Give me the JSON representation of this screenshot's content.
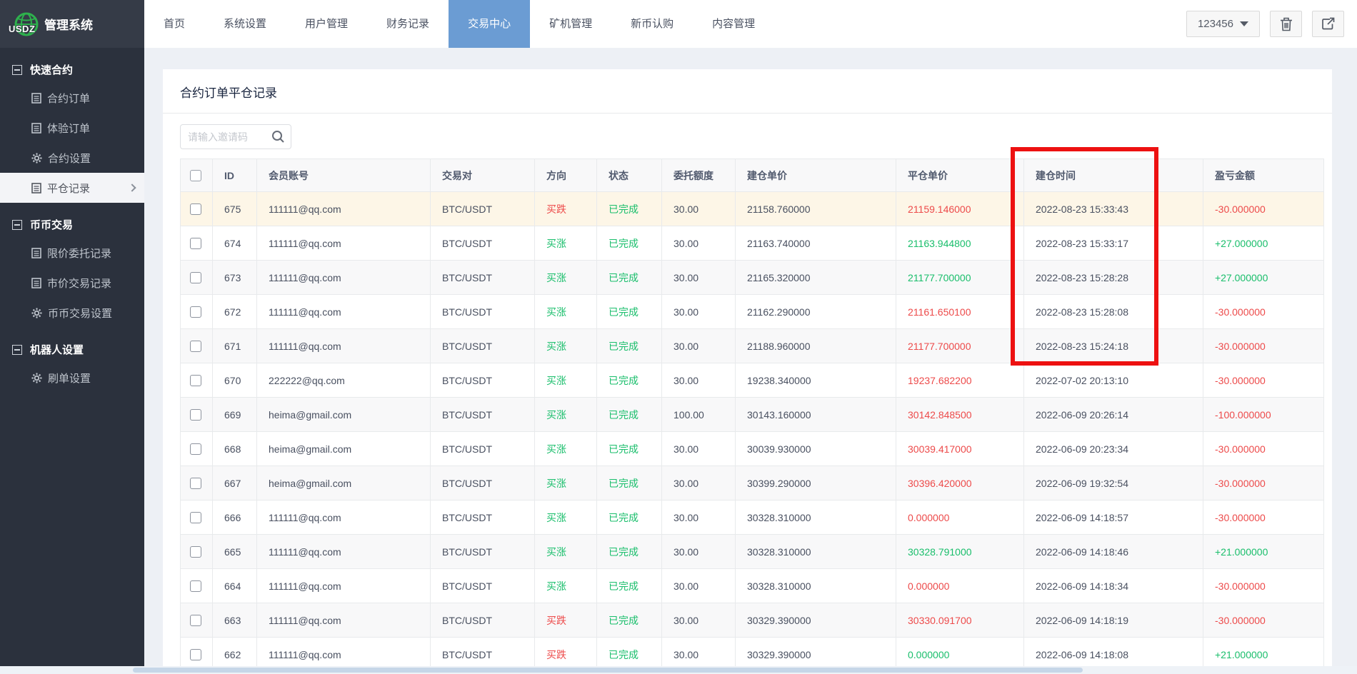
{
  "header": {
    "logo_text": "USDZ",
    "app_name": "管理系统",
    "nav": [
      {
        "label": "首页",
        "active": false
      },
      {
        "label": "系统设置",
        "active": false
      },
      {
        "label": "用户管理",
        "active": false
      },
      {
        "label": "财务记录",
        "active": false
      },
      {
        "label": "交易中心",
        "active": true
      },
      {
        "label": "矿机管理",
        "active": false
      },
      {
        "label": "新币认购",
        "active": false
      },
      {
        "label": "内容管理",
        "active": false
      }
    ],
    "user_menu_label": "123456",
    "icons": [
      "trash-icon",
      "export-icon"
    ]
  },
  "sidebar": {
    "sections": [
      {
        "title": "快速合约",
        "items": [
          {
            "label": "合约订单",
            "icon": "list",
            "active": false
          },
          {
            "label": "体验订单",
            "icon": "list",
            "active": false
          },
          {
            "label": "合约设置",
            "icon": "gear",
            "active": false
          },
          {
            "label": "平仓记录",
            "icon": "list",
            "active": true
          }
        ]
      },
      {
        "title": "币币交易",
        "items": [
          {
            "label": "限价委托记录",
            "icon": "list",
            "active": false
          },
          {
            "label": "市价交易记录",
            "icon": "list",
            "active": false
          },
          {
            "label": "币币交易设置",
            "icon": "gear",
            "active": false
          }
        ]
      },
      {
        "title": "机器人设置",
        "items": [
          {
            "label": "刷单设置",
            "icon": "gear",
            "active": false
          }
        ]
      }
    ]
  },
  "main": {
    "title": "合约订单平仓记录",
    "search_placeholder": "请输入邀请码",
    "table": {
      "columns": [
        "ID",
        "会员账号",
        "交易对",
        "方向",
        "状态",
        "委托额度",
        "建仓单价",
        "平仓单价",
        "建仓时间",
        "盈亏金额"
      ],
      "rows": [
        {
          "id": "675",
          "account": "111111@qq.com",
          "pair": "BTC/USDT",
          "direction": "买跌",
          "direction_color": "red",
          "status": "已完成",
          "amount": "30.00",
          "open_price": "21158.760000",
          "close_price": "21159.146000",
          "close_color": "red",
          "open_time": "2022-08-23 15:33:43",
          "pnl": "-30.000000",
          "pnl_color": "red",
          "highlight": true
        },
        {
          "id": "674",
          "account": "111111@qq.com",
          "pair": "BTC/USDT",
          "direction": "买涨",
          "direction_color": "green",
          "status": "已完成",
          "amount": "30.00",
          "open_price": "21163.740000",
          "close_price": "21163.944800",
          "close_color": "green",
          "open_time": "2022-08-23 15:33:17",
          "pnl": "+27.000000",
          "pnl_color": "green",
          "highlight": false
        },
        {
          "id": "673",
          "account": "111111@qq.com",
          "pair": "BTC/USDT",
          "direction": "买涨",
          "direction_color": "green",
          "status": "已完成",
          "amount": "30.00",
          "open_price": "21165.320000",
          "close_price": "21177.700000",
          "close_color": "green",
          "open_time": "2022-08-23 15:28:28",
          "pnl": "+27.000000",
          "pnl_color": "green",
          "highlight": false
        },
        {
          "id": "672",
          "account": "111111@qq.com",
          "pair": "BTC/USDT",
          "direction": "买涨",
          "direction_color": "green",
          "status": "已完成",
          "amount": "30.00",
          "open_price": "21162.290000",
          "close_price": "21161.650100",
          "close_color": "red",
          "open_time": "2022-08-23 15:28:08",
          "pnl": "-30.000000",
          "pnl_color": "red",
          "highlight": false
        },
        {
          "id": "671",
          "account": "111111@qq.com",
          "pair": "BTC/USDT",
          "direction": "买涨",
          "direction_color": "green",
          "status": "已完成",
          "amount": "30.00",
          "open_price": "21188.960000",
          "close_price": "21177.700000",
          "close_color": "red",
          "open_time": "2022-08-23 15:24:18",
          "pnl": "-30.000000",
          "pnl_color": "red",
          "highlight": false
        },
        {
          "id": "670",
          "account": "222222@qq.com",
          "pair": "BTC/USDT",
          "direction": "买涨",
          "direction_color": "green",
          "status": "已完成",
          "amount": "30.00",
          "open_price": "19238.340000",
          "close_price": "19237.682200",
          "close_color": "red",
          "open_time": "2022-07-02 20:13:10",
          "pnl": "-30.000000",
          "pnl_color": "red",
          "highlight": false
        },
        {
          "id": "669",
          "account": "heima@gmail.com",
          "pair": "BTC/USDT",
          "direction": "买涨",
          "direction_color": "green",
          "status": "已完成",
          "amount": "100.00",
          "open_price": "30143.160000",
          "close_price": "30142.848500",
          "close_color": "red",
          "open_time": "2022-06-09 20:26:14",
          "pnl": "-100.000000",
          "pnl_color": "red",
          "highlight": false
        },
        {
          "id": "668",
          "account": "heima@gmail.com",
          "pair": "BTC/USDT",
          "direction": "买涨",
          "direction_color": "green",
          "status": "已完成",
          "amount": "30.00",
          "open_price": "30039.930000",
          "close_price": "30039.417000",
          "close_color": "red",
          "open_time": "2022-06-09 20:23:34",
          "pnl": "-30.000000",
          "pnl_color": "red",
          "highlight": false
        },
        {
          "id": "667",
          "account": "heima@gmail.com",
          "pair": "BTC/USDT",
          "direction": "买涨",
          "direction_color": "green",
          "status": "已完成",
          "amount": "30.00",
          "open_price": "30399.290000",
          "close_price": "30396.420000",
          "close_color": "red",
          "open_time": "2022-06-09 19:32:54",
          "pnl": "-30.000000",
          "pnl_color": "red",
          "highlight": false
        },
        {
          "id": "666",
          "account": "111111@qq.com",
          "pair": "BTC/USDT",
          "direction": "买涨",
          "direction_color": "green",
          "status": "已完成",
          "amount": "30.00",
          "open_price": "30328.310000",
          "close_price": "0.000000",
          "close_color": "red",
          "open_time": "2022-06-09 14:18:57",
          "pnl": "-30.000000",
          "pnl_color": "red",
          "highlight": false
        },
        {
          "id": "665",
          "account": "111111@qq.com",
          "pair": "BTC/USDT",
          "direction": "买涨",
          "direction_color": "green",
          "status": "已完成",
          "amount": "30.00",
          "open_price": "30328.310000",
          "close_price": "30328.791000",
          "close_color": "green",
          "open_time": "2022-06-09 14:18:46",
          "pnl": "+21.000000",
          "pnl_color": "green",
          "highlight": false
        },
        {
          "id": "664",
          "account": "111111@qq.com",
          "pair": "BTC/USDT",
          "direction": "买涨",
          "direction_color": "green",
          "status": "已完成",
          "amount": "30.00",
          "open_price": "30328.310000",
          "close_price": "0.000000",
          "close_color": "red",
          "open_time": "2022-06-09 14:18:34",
          "pnl": "-30.000000",
          "pnl_color": "red",
          "highlight": false
        },
        {
          "id": "663",
          "account": "111111@qq.com",
          "pair": "BTC/USDT",
          "direction": "买跌",
          "direction_color": "red",
          "status": "已完成",
          "amount": "30.00",
          "open_price": "30329.390000",
          "close_price": "30330.091700",
          "close_color": "red",
          "open_time": "2022-06-09 14:18:19",
          "pnl": "-30.000000",
          "pnl_color": "red",
          "highlight": false
        },
        {
          "id": "662",
          "account": "111111@qq.com",
          "pair": "BTC/USDT",
          "direction": "买跌",
          "direction_color": "red",
          "status": "已完成",
          "amount": "30.00",
          "open_price": "30329.390000",
          "close_price": "0.000000",
          "close_color": "green",
          "open_time": "2022-06-09 14:18:08",
          "pnl": "+21.000000",
          "pnl_color": "green",
          "highlight": false
        }
      ]
    }
  },
  "colors": {
    "red": "#ed4a4a",
    "green": "#19be6b",
    "status_green": "#19be6b",
    "nav_active_blue": "#6b9cd3",
    "annotation_red": "#ed1111",
    "logo_green": "#2eb14d"
  },
  "annotation": {
    "highlighted_column": "建仓时间"
  }
}
